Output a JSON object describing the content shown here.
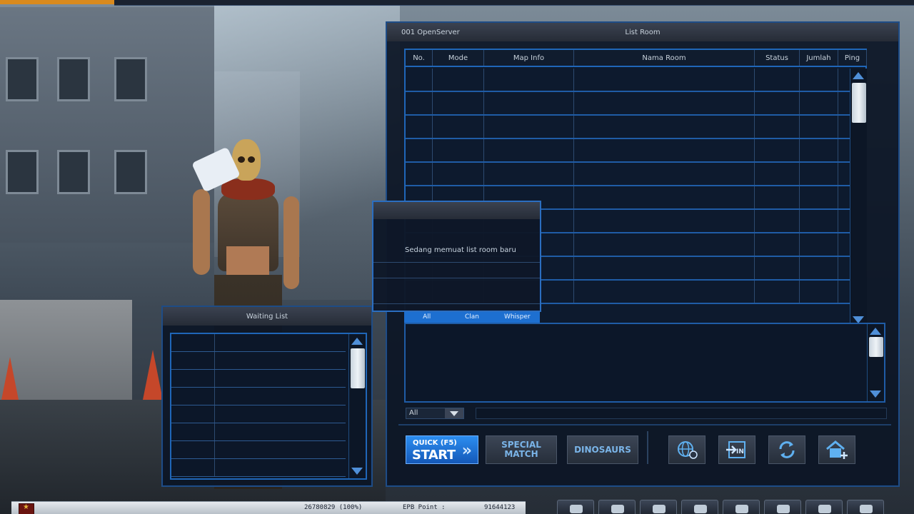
{
  "list_room": {
    "server": "001 OpenServer",
    "title": "List Room",
    "columns": [
      "No.",
      "Mode",
      "Map Info",
      "Nama Room",
      "Status",
      "Jumlah",
      "Ping"
    ],
    "row_count": 10
  },
  "chat": {
    "tabs": [
      "All",
      "Clan",
      "Whisper"
    ],
    "filter_value": "All"
  },
  "buttons": {
    "quick_start_small": "QUICK (F5)",
    "quick_start_big": "START",
    "special_match": "SPECIAL MATCH",
    "dinosaurs": "DINOSAURS",
    "icons": [
      "globe-icon",
      "enter-icon",
      "refresh-icon",
      "home-plus-icon"
    ]
  },
  "waiting_list": {
    "title": "Waiting List",
    "row_count": 8
  },
  "loading_dialog": {
    "message": "Sedang memuat list room baru"
  },
  "status_bar": {
    "exp": "26780829 (100%)",
    "epb_label": "EPB Point :",
    "epb_value": "91644123"
  },
  "colors": {
    "accent": "#1f66b8",
    "button_blue": "#2c8ef0",
    "panel_bg": "#0c1729"
  }
}
